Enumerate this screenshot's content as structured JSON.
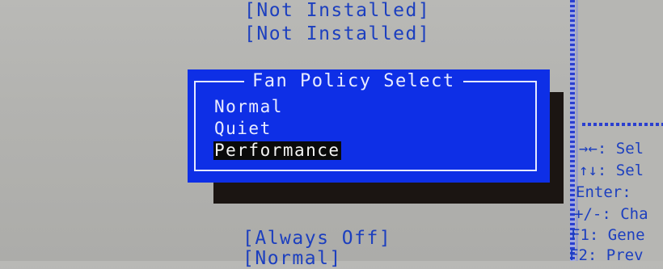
{
  "settings_values": {
    "row1": "[Not Installed]",
    "row2": "[Not Installed]",
    "row3": "[Always Off]",
    "row4": "[Normal]"
  },
  "popup": {
    "title": "Fan Policy Select",
    "options": [
      "Normal",
      "Quiet",
      "Performance"
    ],
    "selected": "Performance"
  },
  "help_panel": {
    "lines": [
      "→←: Sel",
      "↑↓: Sel",
      "Enter: ",
      "+/-: Cha",
      "F1: Gene",
      "F2: Prev"
    ]
  },
  "colors": {
    "background": "#b6b6b3",
    "value_text": "#1c3fbf",
    "popup_bg": "#0e2fe6",
    "popup_text": "#e9ecff",
    "selection_bg": "#0a0a0a"
  }
}
